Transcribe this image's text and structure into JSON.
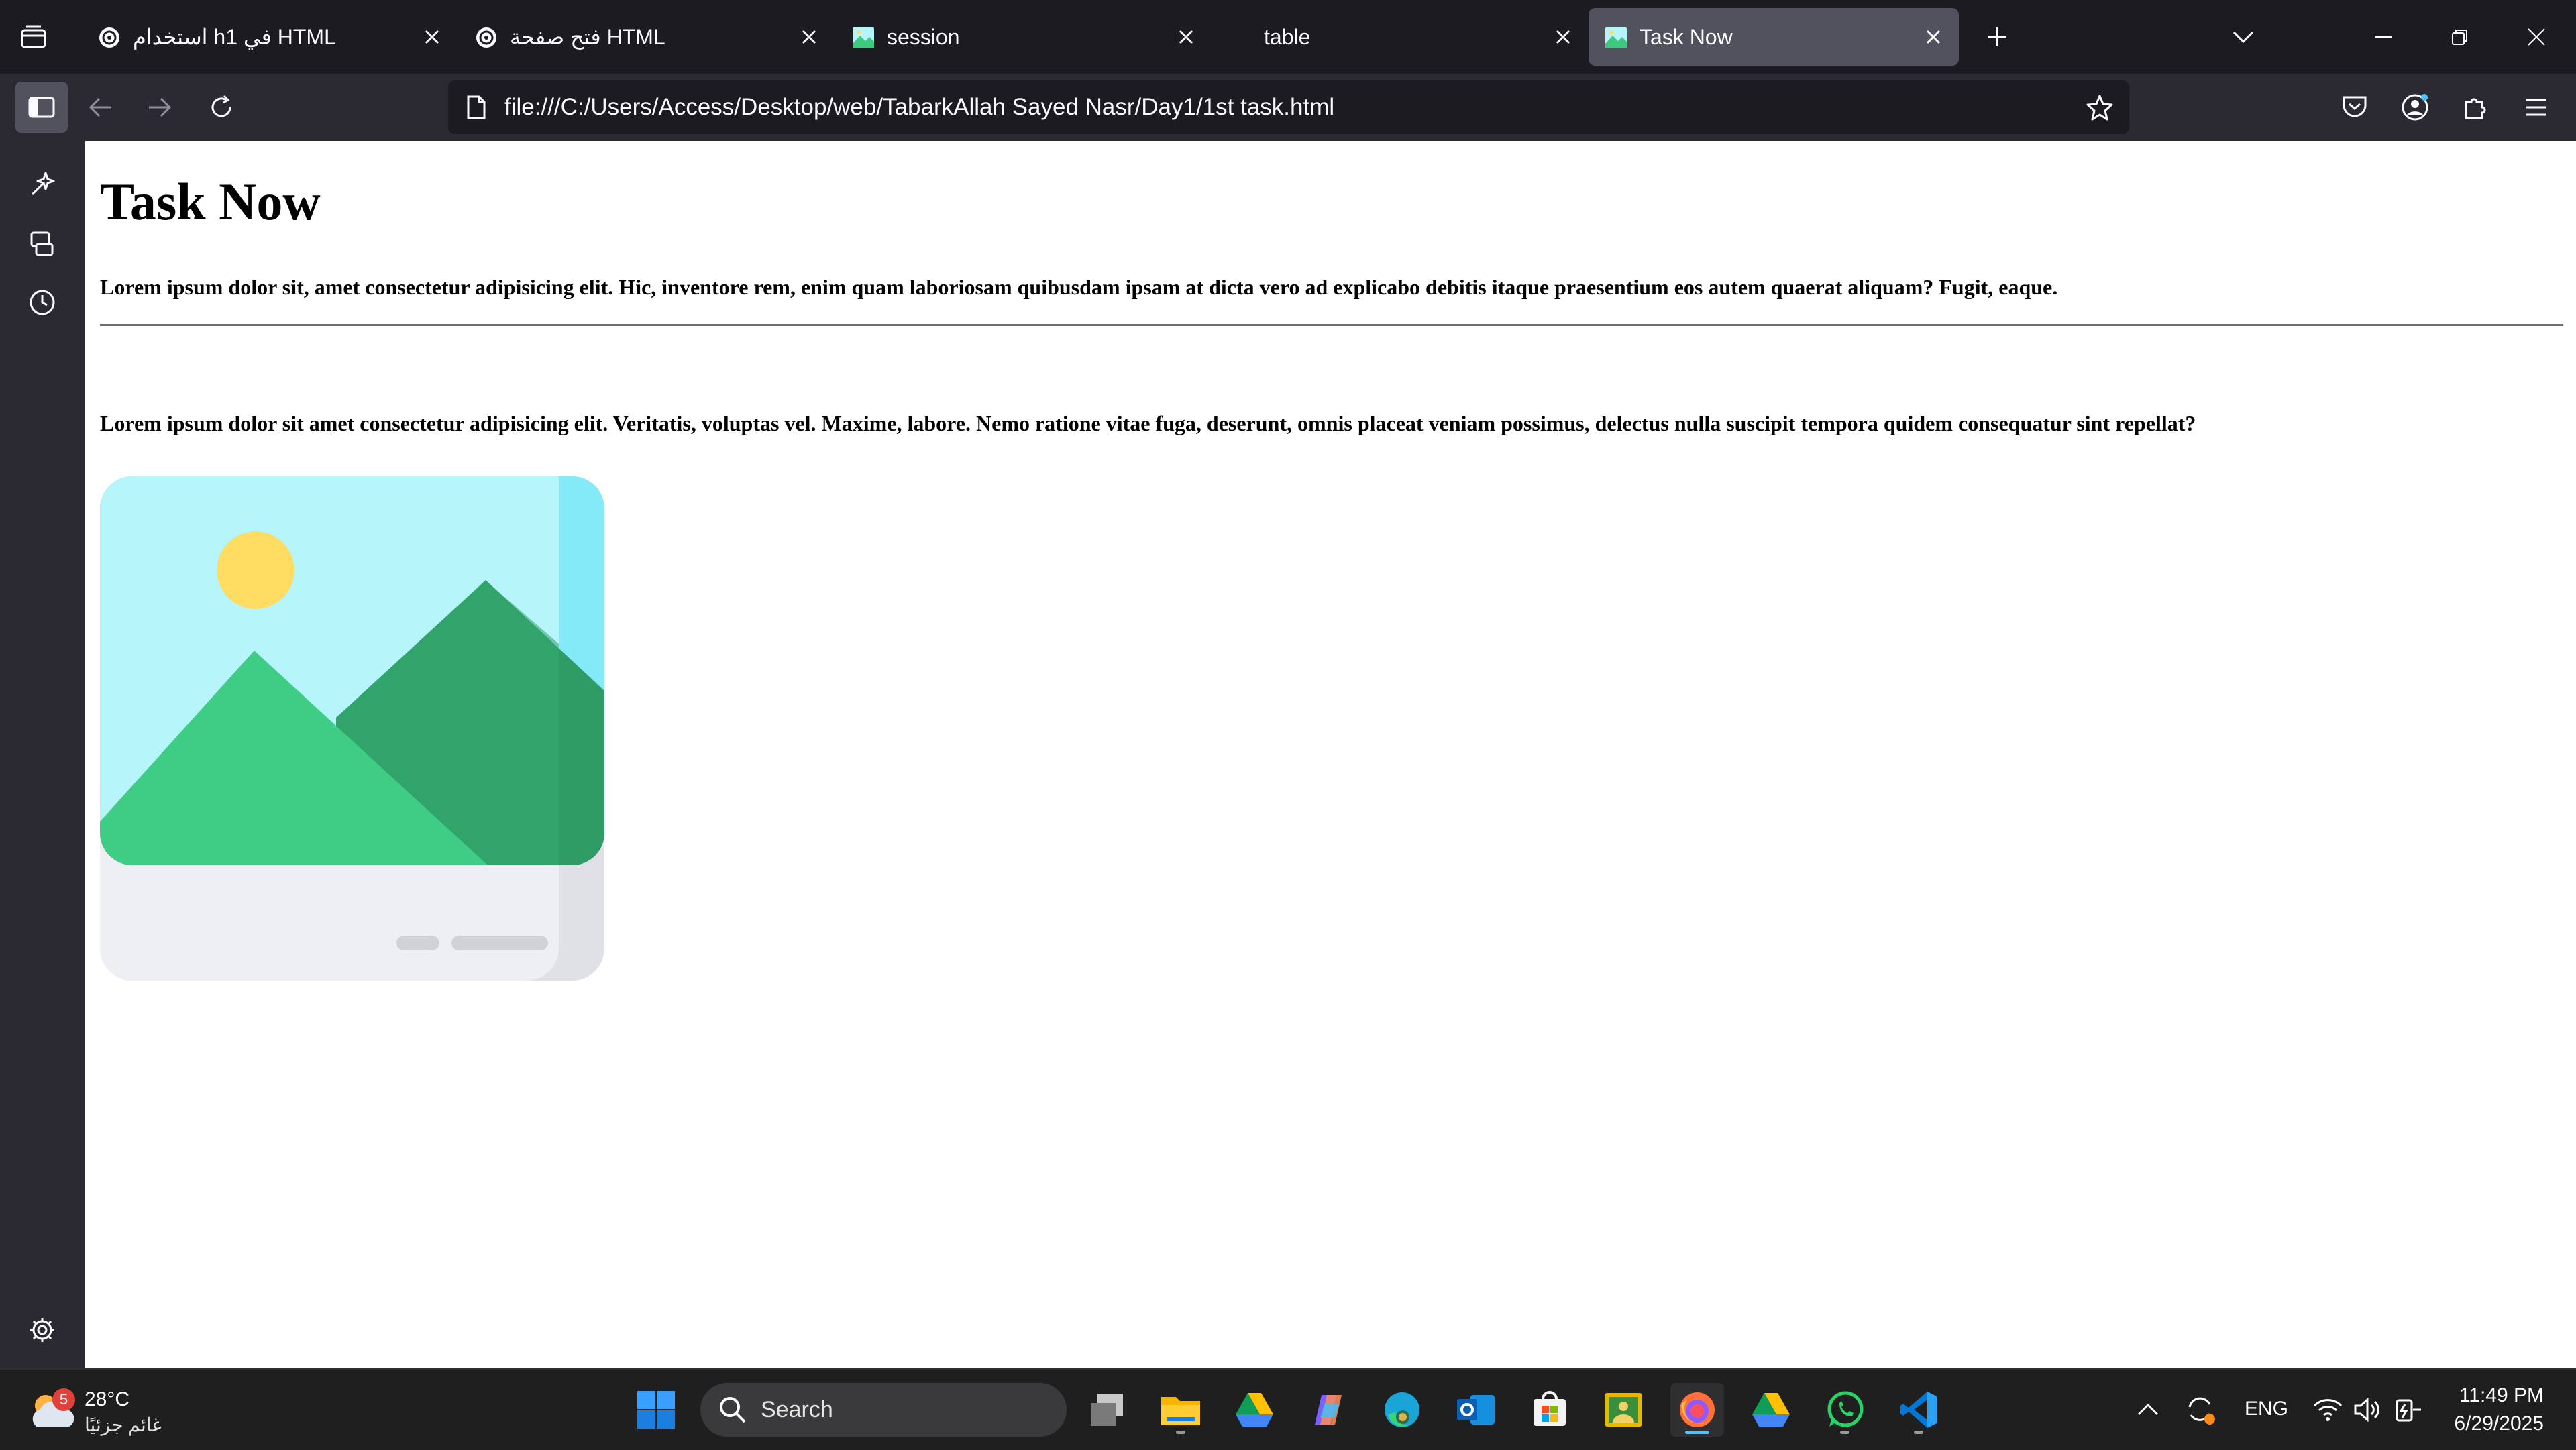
{
  "browser": {
    "tabs": [
      {
        "title": "استخدام h1 في HTML",
        "favicon": "chatgpt-icon",
        "active": false
      },
      {
        "title": "فتح صفحة HTML",
        "favicon": "chatgpt-icon",
        "active": false
      },
      {
        "title": "session",
        "favicon": "image-icon",
        "active": false
      },
      {
        "title": "table",
        "favicon": "",
        "active": false
      },
      {
        "title": "Task Now",
        "favicon": "image-icon",
        "active": true
      }
    ],
    "url": "file:///C:/Users/Access/Desktop/web/TabarkAllah Sayed Nasr/Day1/1st task.html"
  },
  "page": {
    "heading": "Task Now",
    "paragraph1": "Lorem ipsum dolor sit, amet consectetur adipisicing elit. Hic, inventore rem, enim quam laboriosam quibusdam ipsam at dicta vero ad explicabo debitis itaque praesentium eos autem quaerat aliquam? Fugit, eaque.",
    "paragraph2": "Lorem ipsum dolor sit amet consectetur adipisicing elit. Veritatis, voluptas vel. Maxime, labore. Nemo ratione vitae fuga, deserunt, omnis placeat veniam possimus, delectus nulla suscipit tempora quidem consequatur sint repellat?",
    "image_icon": "image-placeholder-icon"
  },
  "taskbar": {
    "weather_temp": "28°C",
    "weather_condition": "غائم جزئيًا",
    "weather_badge": "5",
    "search_placeholder": "Search",
    "language": "ENG",
    "time": "11:49 PM",
    "date": "6/29/2025",
    "apps": [
      "task-view",
      "file-explorer",
      "google-drive",
      "copilot",
      "edge",
      "outlook",
      "microsoft-store",
      "photos",
      "firefox",
      "google-drive",
      "whatsapp",
      "vscode"
    ]
  },
  "colors": {
    "tab_active": "#52525e",
    "toolbar": "#2b2a33",
    "taskbar": "#1f1f20",
    "accent": "#4cc2ff"
  }
}
